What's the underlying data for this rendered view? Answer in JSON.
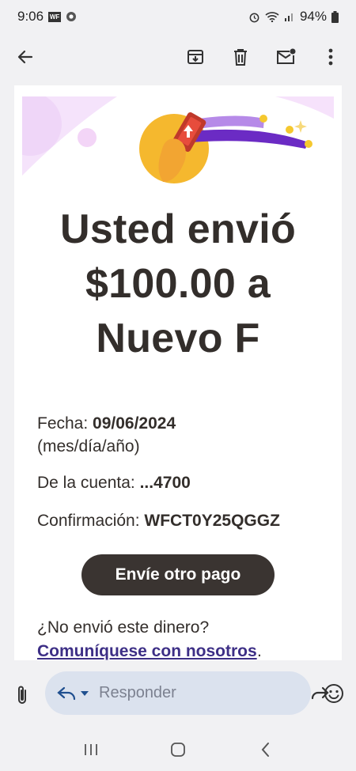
{
  "status_bar": {
    "time": "9:06",
    "battery": "94%",
    "icons": [
      "wf-icon",
      "chrome-icon",
      "alarm-icon",
      "wifi-icon",
      "signal-icon",
      "battery-icon"
    ]
  },
  "toolbar": {
    "icons": [
      "back-arrow-icon",
      "archive-icon",
      "delete-icon",
      "mark-unread-icon",
      "more-vert-icon"
    ]
  },
  "email": {
    "headline": [
      "Usted envió",
      "$100.00 a",
      "Nuevo F"
    ],
    "date_label": "Fecha:",
    "date_value": "09/06/2024",
    "date_format": "(mes/día/año)",
    "account_label": "De la cuenta:",
    "account_value": "...4700",
    "confirmation_label": "Confirmación:",
    "confirmation_value": "WFCT0Y25QGGZ",
    "cta_label": "Envíe otro pago",
    "question": "¿No envió este dinero?",
    "contact_link": "Comuníquese con nosotros",
    "contact_suffix": "."
  },
  "reply_bar": {
    "placeholder": "Responder"
  },
  "colors": {
    "cta_bg": "#3a3431",
    "link": "#3d2f86",
    "accent_purple": "#8a3bd8",
    "accent_gold": "#f5b82e",
    "hero_bg": "#f5e6fb"
  }
}
